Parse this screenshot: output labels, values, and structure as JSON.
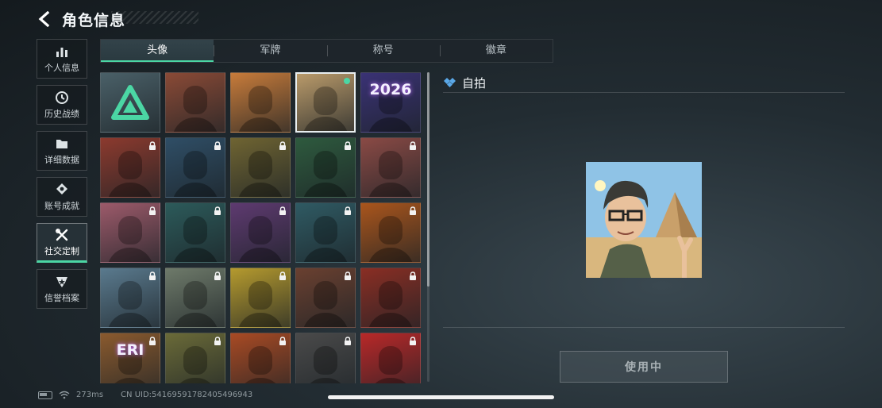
{
  "header": {
    "title": "角色信息"
  },
  "sidebar": {
    "items": [
      {
        "label": "个人信息"
      },
      {
        "label": "历史战绩"
      },
      {
        "label": "详细数据"
      },
      {
        "label": "账号成就"
      },
      {
        "label": "社交定制",
        "active": true
      },
      {
        "label": "信誉档案"
      }
    ]
  },
  "tabs": [
    {
      "label": "头像",
      "active": true
    },
    {
      "label": "军牌"
    },
    {
      "label": "称号"
    },
    {
      "label": "徽章"
    }
  ],
  "avatars": [
    {
      "name": "default-logo",
      "color": "#4a6068",
      "locked": false
    },
    {
      "name": "masked-reader",
      "color": "#8a4a36",
      "locked": false
    },
    {
      "name": "monkey-reader",
      "color": "#c77b3a",
      "locked": false
    },
    {
      "name": "selfie-pyramid",
      "color": "#b99a6a",
      "locked": false,
      "selected": true
    },
    {
      "name": "fireworks-2026",
      "color": "#3a3275",
      "locked": false,
      "label": "2026"
    },
    {
      "name": "operator-red",
      "color": "#8c3a2e",
      "locked": true
    },
    {
      "name": "operator-blue",
      "color": "#2f4e66",
      "locked": true
    },
    {
      "name": "operator-olive",
      "color": "#6f6432",
      "locked": true
    },
    {
      "name": "operator-green",
      "color": "#2e5a3e",
      "locked": true
    },
    {
      "name": "operator-rose",
      "color": "#8a4a45",
      "locked": true
    },
    {
      "name": "operator-pink",
      "color": "#9c5a6a",
      "locked": true
    },
    {
      "name": "operator-teal",
      "color": "#2c5a5a",
      "locked": true
    },
    {
      "name": "operator-purple",
      "color": "#5e3a70",
      "locked": true
    },
    {
      "name": "operator-mask-teal",
      "color": "#2f5a63",
      "locked": true
    },
    {
      "name": "operator-orange",
      "color": "#a9551c",
      "locked": true
    },
    {
      "name": "star-emblem",
      "color": "#5a7a8e",
      "locked": true
    },
    {
      "name": "landscape-heli",
      "color": "#6e7a6a",
      "locked": true
    },
    {
      "name": "glove-emblem",
      "color": "#b59a2e",
      "locked": true
    },
    {
      "name": "tent-emblem",
      "color": "#6a4030",
      "locked": true
    },
    {
      "name": "operator-redhair",
      "color": "#8a2e24",
      "locked": true
    },
    {
      "name": "eri-emblem",
      "color": "#8a5a2e",
      "locked": true,
      "label": "ERI"
    },
    {
      "name": "operator-glasses",
      "color": "#6a6a38",
      "locked": true
    },
    {
      "name": "explosion",
      "color": "#a84a24",
      "locked": true
    },
    {
      "name": "soldiers-bw",
      "color": "#4a4a4a",
      "locked": true
    },
    {
      "name": "red-shield",
      "color": "#b82828",
      "locked": true
    }
  ],
  "detail": {
    "title": "自拍",
    "button_label": "使用中",
    "button_active": false
  },
  "status": {
    "ping": "273ms",
    "uid": "CN UID:54169591782405496943"
  },
  "colors": {
    "accent": "#4bd6a4"
  }
}
